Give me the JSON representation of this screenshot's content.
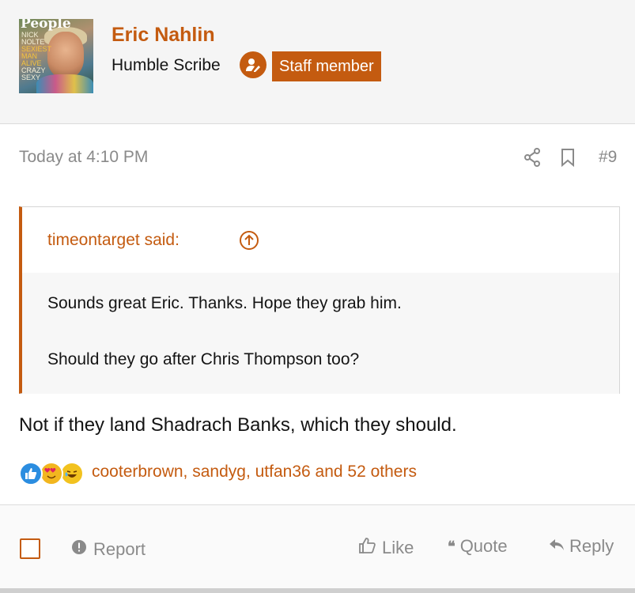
{
  "author": {
    "avatar": {
      "magazine": "People",
      "cover_lines": [
        "NICK",
        "NOLTE",
        "SEXIEST",
        "MAN",
        "ALIVE",
        "CRAZY",
        "SEXY"
      ]
    },
    "name": "Eric Nahlin",
    "user_title": "Humble Scribe",
    "staff_icon": "user-edit-icon",
    "badge": "Staff member"
  },
  "post": {
    "date": "Today at 4:10 PM",
    "number": "#9",
    "quote": {
      "author_text": "timeontarget said:",
      "lines": [
        "Sounds great Eric. Thanks. Hope they grab him.",
        "Should they go after Chris Thompson too?"
      ]
    },
    "body": "Not if they land Shadrach Banks, which they should.",
    "reactions": {
      "icons": [
        "like-icon",
        "love-icon",
        "laugh-icon"
      ],
      "users_text": "cooterbrown, sandyg, utfan36 and 52 others"
    }
  },
  "actions": {
    "report": "Report",
    "like": "Like",
    "quote": "Quote",
    "reply": "Reply"
  },
  "colors": {
    "accent": "#c45b10",
    "muted": "#8a8a8a",
    "text": "#141414"
  }
}
